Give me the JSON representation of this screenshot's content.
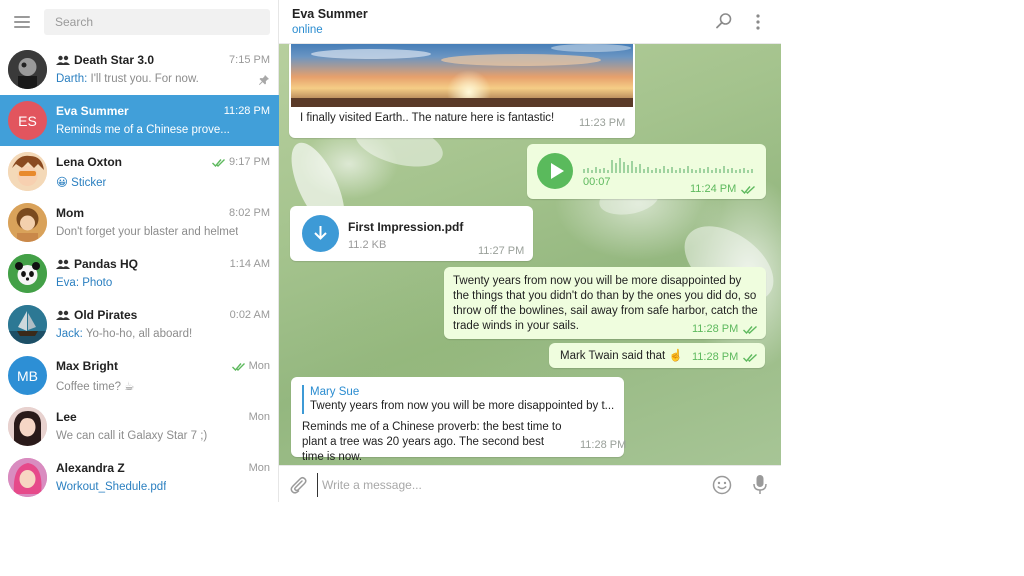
{
  "sidebar": {
    "search_placeholder": "Search",
    "chats": [
      {
        "name": "Death Star 3.0",
        "time": "7:15 PM",
        "sender": "Darth:",
        "preview": " I'll trust you. For now.",
        "group": true,
        "pinned": true
      },
      {
        "name": "Eva Summer",
        "time": "11:28 PM",
        "initials": "ES",
        "preview": "Reminds me of a Chinese prove...",
        "active": true
      },
      {
        "name": "Lena Oxton",
        "time": "9:17 PM",
        "preview": "😀 Sticker",
        "read": true
      },
      {
        "name": "Mom",
        "time": "8:02 PM",
        "preview": "Don't forget your blaster and helmet"
      },
      {
        "name": "Pandas HQ",
        "time": "1:14 AM",
        "sender": "Eva:",
        "preview": " Photo",
        "group": true
      },
      {
        "name": "Old Pirates",
        "time": "0:02 AM",
        "sender": "Jack:",
        "preview": " Yo-ho-ho, all aboard!",
        "group": true
      },
      {
        "name": "Max Bright",
        "time": "Mon",
        "initials": "MB",
        "preview": "Coffee time? ☕",
        "read": true
      },
      {
        "name": "Lee",
        "time": "Mon",
        "preview": "We can call it Galaxy Star 7 ;)"
      },
      {
        "name": "Alexandra Z",
        "time": "Mon",
        "preview": "Workout_Shedule.pdf"
      }
    ]
  },
  "header": {
    "peer_name": "Eva Summer",
    "peer_status": "online"
  },
  "messages": {
    "photo": {
      "caption": "I finally visited Earth.. The nature here is fantastic!",
      "time": "11:23 PM"
    },
    "voice": {
      "duration": "00:07",
      "time": "11:24 PM"
    },
    "file": {
      "name": "First Impression.pdf",
      "size": "11.2 KB",
      "time": "11:27 PM"
    },
    "quote": {
      "text": "Twenty years from now you will be more disappointed by the things that you didn't do than by the ones you did do, so throw off the bowlines, sail away from safe harbor, catch the trade winds in your sails.",
      "time": "11:28 PM"
    },
    "twain": {
      "text": "Mark Twain said that ☝️",
      "time": "11:28 PM"
    },
    "reply": {
      "quoted_author": "Mary Sue",
      "quoted_text": "Twenty years from now you will be more disappointed by t...",
      "text": "Reminds me of a Chinese proverb: the best time to plant a tree was 20 years ago. The second best time is now.",
      "time": "11:28 PM"
    }
  },
  "composer": {
    "placeholder": "Write a message..."
  },
  "colors": {
    "accent": "#419fd9",
    "outgoing_bubble": "#effdde",
    "read_check": "#5eb95e"
  }
}
